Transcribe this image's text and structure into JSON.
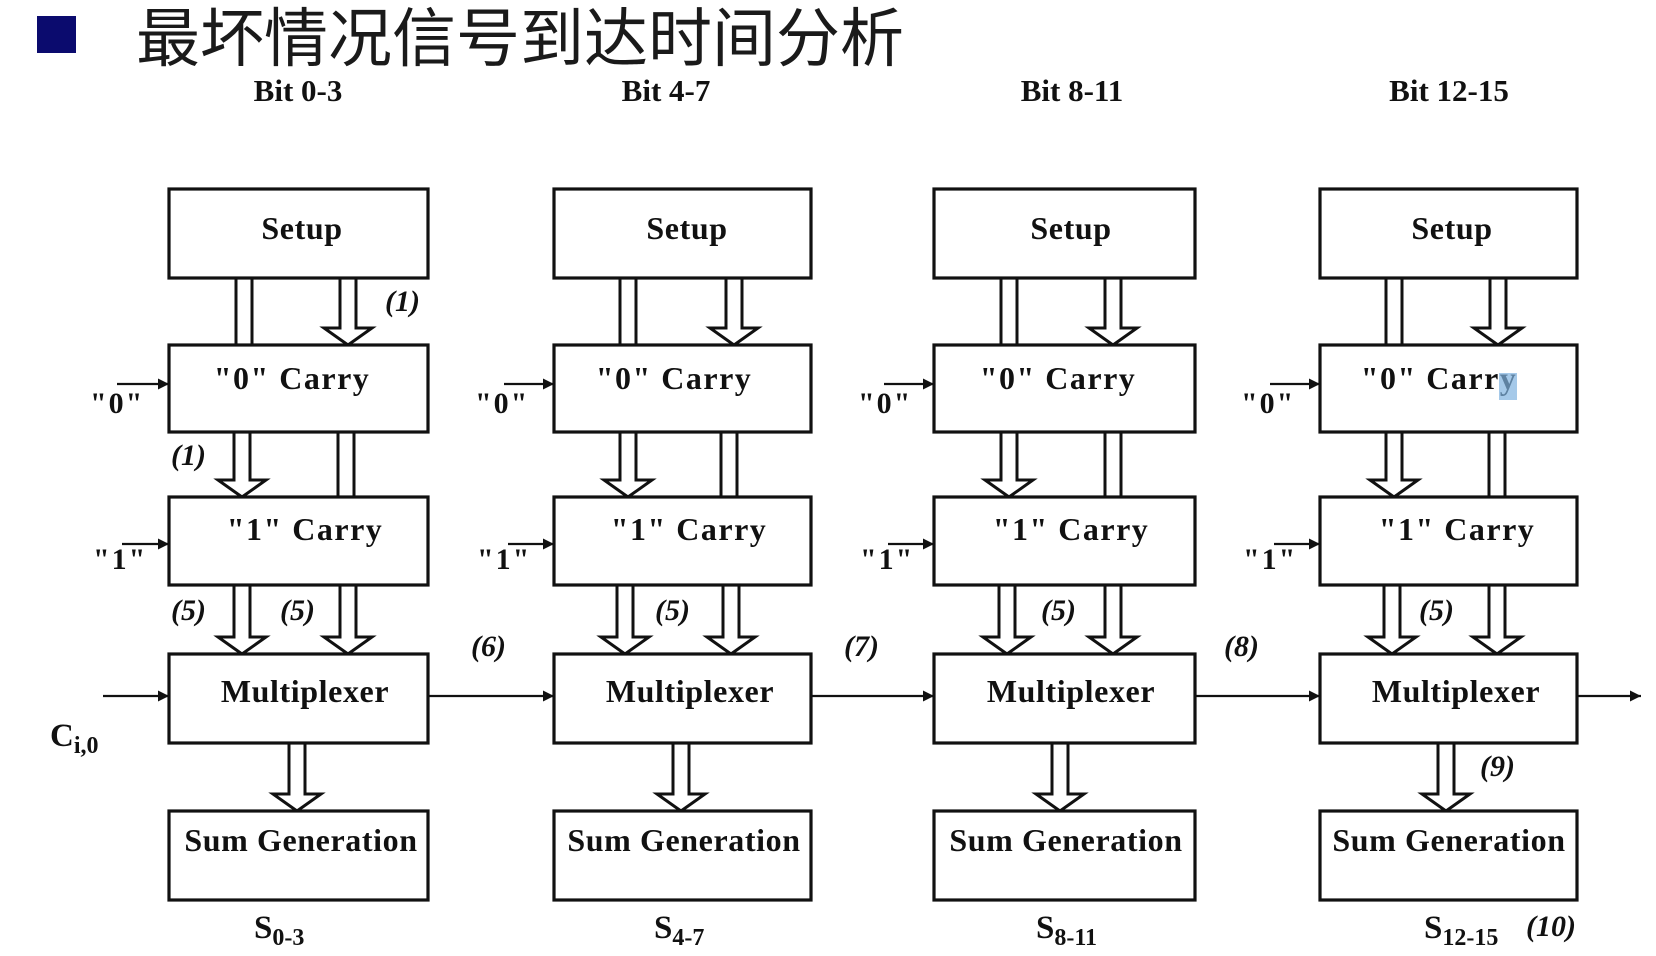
{
  "slide": {
    "title": "最坏情况信号到达时间分析",
    "bullet_color": "#0b0b6e"
  },
  "columns": [
    {
      "bit_label": "Bit 0-3",
      "setup": "Setup",
      "carry0": "\"0\" Carry",
      "carry1": "\"1\" Carry",
      "mux": "Multiplexer",
      "sum": "Sum Generation",
      "input0": "\"0\"",
      "input1": "\"1\"",
      "sum_out": {
        "symbol": "S",
        "subscript": "0-3"
      }
    },
    {
      "bit_label": "Bit 4-7",
      "setup": "Setup",
      "carry0": "\"0\" Carry",
      "carry1": "\"1\" Carry",
      "mux": "Multiplexer",
      "sum": "Sum Generation",
      "input0": "\"0\"",
      "input1": "\"1\"",
      "sum_out": {
        "symbol": "S",
        "subscript": "4-7"
      }
    },
    {
      "bit_label": "Bit 8-11",
      "setup": "Setup",
      "carry0": "\"0\" Carry",
      "carry1": "\"1\" Carry",
      "mux": "Multiplexer",
      "sum": "Sum Generation",
      "input0": "\"0\"",
      "input1": "\"1\"",
      "sum_out": {
        "symbol": "S",
        "subscript": "8-11"
      }
    },
    {
      "bit_label": "Bit 12-15",
      "setup": "Setup",
      "carry0": "\"0\" Carry",
      "carry1": "\"1\" Carry",
      "mux": "Multiplexer",
      "sum": "Sum Generation",
      "input0": "\"0\"",
      "input1": "\"1\"",
      "sum_out": {
        "symbol": "S",
        "subscript": "12-15"
      }
    }
  ],
  "carry_in": {
    "symbol": "C",
    "subscript": "i,0"
  },
  "delays": {
    "col1_setup_to_carry0": "(1)",
    "col1_carry0_to_carry1": "(1)",
    "col1_carry1_to_mux_left": "(5)",
    "col1_carry1_to_mux_right": "(5)",
    "mux1_to_mux2": "(6)",
    "col2_carry1_to_mux": "(5)",
    "mux2_to_mux3": "(7)",
    "col3_carry1_to_mux": "(5)",
    "mux3_to_mux4": "(8)",
    "col4_carry1_to_mux": "(5)",
    "col4_mux_to_sum": "(9)",
    "final_sum": "(10)"
  }
}
